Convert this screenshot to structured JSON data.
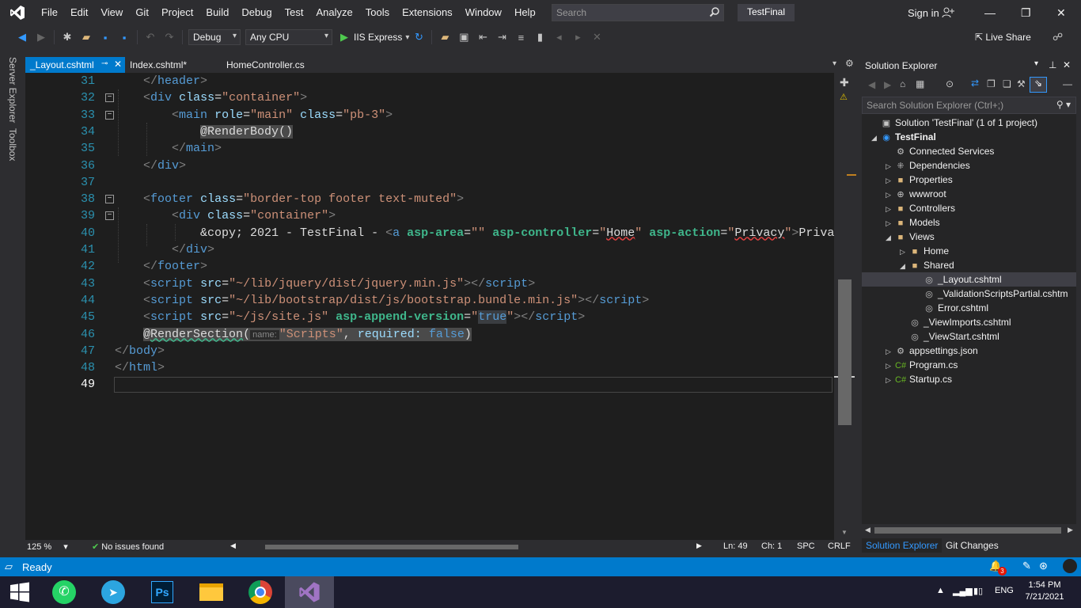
{
  "menu": {
    "items": [
      "File",
      "Edit",
      "View",
      "Git",
      "Project",
      "Build",
      "Debug",
      "Test",
      "Analyze",
      "Tools",
      "Extensions",
      "Window",
      "Help"
    ],
    "search_placeholder": "Search",
    "solution_name": "TestFinal",
    "sign_in": "Sign in"
  },
  "toolbar": {
    "config": "Debug",
    "platform": "Any CPU",
    "run_target": "IIS Express",
    "live_share": "Live Share"
  },
  "side_tabs": [
    "Server Explorer",
    "Toolbox"
  ],
  "tabs": [
    {
      "label": "_Layout.cshtml",
      "active": true
    },
    {
      "label": "Index.cshtml*",
      "active": false
    },
    {
      "label": "HomeController.cs",
      "active": false
    }
  ],
  "code_lines": [
    {
      "n": "31",
      "html": "    <span class=\"tag\">&lt;/</span><span class=\"tn\">header</span><span class=\"tag\">&gt;</span>"
    },
    {
      "n": "32",
      "html": "    <span class=\"tag\">&lt;</span><span class=\"tn\">div</span> <span class=\"at\">class</span><span class=\"txt\">=</span><span class=\"av\">\"container\"</span><span class=\"tag\">&gt;</span>"
    },
    {
      "n": "33",
      "html": "        <span class=\"tag\">&lt;</span><span class=\"tn\">main</span> <span class=\"at\">role</span><span class=\"txt\">=</span><span class=\"av\">\"main\"</span> <span class=\"at\">class</span><span class=\"txt\">=</span><span class=\"av\">\"pb-3\"</span><span class=\"tag\">&gt;</span>"
    },
    {
      "n": "34",
      "html": "            <span class=\"razor\">@RenderBody()</span>"
    },
    {
      "n": "35",
      "html": "        <span class=\"tag\">&lt;/</span><span class=\"tn\">main</span><span class=\"tag\">&gt;</span>"
    },
    {
      "n": "36",
      "html": "    <span class=\"tag\">&lt;/</span><span class=\"tn\">div</span><span class=\"tag\">&gt;</span>"
    },
    {
      "n": "37",
      "html": ""
    },
    {
      "n": "38",
      "html": "    <span class=\"tag\">&lt;</span><span class=\"tn\">footer</span> <span class=\"at\">class</span><span class=\"txt\">=</span><span class=\"av\">\"border-top footer text-muted\"</span><span class=\"tag\">&gt;</span>"
    },
    {
      "n": "39",
      "html": "        <span class=\"tag\">&lt;</span><span class=\"tn\">div</span> <span class=\"at\">class</span><span class=\"txt\">=</span><span class=\"av\">\"container\"</span><span class=\"tag\">&gt;</span>"
    },
    {
      "n": "40",
      "html": "            <span class=\"txt\">&amp;copy; 2021 - TestFinal - </span><span class=\"tag\">&lt;</span><span class=\"tn\">a</span> <span class=\"at\" style=\"color:#3fb68b;font-weight:bold\">asp-area</span><span class=\"txt\">=</span><span class=\"av\">\"\"</span> <span class=\"at\" style=\"color:#3fb68b;font-weight:bold\">asp-controller</span><span class=\"txt\">=</span><span class=\"av\">\"</span><span class=\"txt\" style=\"text-decoration:underline wavy #e04040\">Home</span><span class=\"av\">\"</span> <span class=\"at\" style=\"color:#3fb68b;font-weight:bold\">asp-action</span><span class=\"txt\">=</span><span class=\"av\">\"</span><span class=\"txt\" style=\"text-decoration:underline wavy #e04040\">Privacy</span><span class=\"av\">\"</span><span class=\"tag\">&gt;</span><span class=\"txt\">Privac</span>"
    },
    {
      "n": "41",
      "html": "        <span class=\"tag\">&lt;/</span><span class=\"tn\">div</span><span class=\"tag\">&gt;</span>"
    },
    {
      "n": "42",
      "html": "    <span class=\"tag\">&lt;/</span><span class=\"tn\">footer</span><span class=\"tag\">&gt;</span>"
    },
    {
      "n": "43",
      "html": "    <span class=\"tag\">&lt;</span><span class=\"tn\">script</span> <span class=\"at\">src</span><span class=\"txt\">=</span><span class=\"av\">\"~/lib/jquery/dist/jquery.min.js\"</span><span class=\"tag\">&gt;&lt;/</span><span class=\"tn\">script</span><span class=\"tag\">&gt;</span>"
    },
    {
      "n": "44",
      "html": "    <span class=\"tag\">&lt;</span><span class=\"tn\">script</span> <span class=\"at\">src</span><span class=\"txt\">=</span><span class=\"av\">\"~/lib/bootstrap/dist/js/bootstrap.bundle.min.js\"</span><span class=\"tag\">&gt;&lt;/</span><span class=\"tn\">script</span><span class=\"tag\">&gt;</span>"
    },
    {
      "n": "45",
      "html": "    <span class=\"tag\">&lt;</span><span class=\"tn\">script</span> <span class=\"at\">src</span><span class=\"txt\">=</span><span class=\"av\">\"~/js/site.js\"</span> <span class=\"at\" style=\"color:#3fb68b;font-weight:bold\">asp-append-version</span><span class=\"txt\">=</span><span class=\"av\">\"</span><span class=\"tn\" style=\"background:#3a3d41\">true</span><span class=\"av\">\"</span><span class=\"tag\">&gt;&lt;/</span><span class=\"tn\">script</span><span class=\"tag\">&gt;</span>"
    },
    {
      "n": "46",
      "html": "    <span class=\"razor\">@<span style=\"text-decoration:underline wavy #3fb68b\">RenderSection</span>(<span class=\"hint\"> name: </span><span class=\"av\">\"Scripts\"</span>, <span class=\"at\">required:</span> <span class=\"tn\">false</span>)</span>"
    },
    {
      "n": "47",
      "html": "<span class=\"tag\">&lt;/</span><span class=\"tn\">body</span><span class=\"tag\">&gt;</span>"
    },
    {
      "n": "48",
      "html": "<span class=\"tag\">&lt;/</span><span class=\"tn\">html</span><span class=\"tag\">&gt;</span>"
    },
    {
      "n": "49",
      "html": ""
    }
  ],
  "editor_status": {
    "zoom": "125 %",
    "issues": "No issues found",
    "ln": "Ln: 49",
    "ch": "Ch: 1",
    "spc": "SPC",
    "crlf": "CRLF"
  },
  "solution_explorer": {
    "title": "Solution Explorer",
    "search_placeholder": "Search Solution Explorer (Ctrl+;)",
    "tree": [
      {
        "label": "Solution 'TestFinal' (1 of 1 project)",
        "depth": 0,
        "arrow": "",
        "icon": "▣",
        "color": "#c5c5c5"
      },
      {
        "label": "TestFinal",
        "depth": 0,
        "arrow": "◢",
        "icon": "◉",
        "color": "#3399ff",
        "bold": true
      },
      {
        "label": "Connected Services",
        "depth": 1,
        "arrow": "",
        "icon": "⚙",
        "color": "#c5c5c5"
      },
      {
        "label": "Dependencies",
        "depth": 1,
        "arrow": "▷",
        "icon": "⁜",
        "color": "#c5c5c5"
      },
      {
        "label": "Properties",
        "depth": 1,
        "arrow": "▷",
        "icon": "■",
        "color": "#dcb67a"
      },
      {
        "label": "wwwroot",
        "depth": 1,
        "arrow": "▷",
        "icon": "⊕",
        "color": "#c5c5c5"
      },
      {
        "label": "Controllers",
        "depth": 1,
        "arrow": "▷",
        "icon": "■",
        "color": "#dcb67a"
      },
      {
        "label": "Models",
        "depth": 1,
        "arrow": "▷",
        "icon": "■",
        "color": "#dcb67a"
      },
      {
        "label": "Views",
        "depth": 1,
        "arrow": "◢",
        "icon": "■",
        "color": "#dcb67a"
      },
      {
        "label": "Home",
        "depth": 2,
        "arrow": "▷",
        "icon": "■",
        "color": "#dcb67a"
      },
      {
        "label": "Shared",
        "depth": 2,
        "arrow": "◢",
        "icon": "■",
        "color": "#dcb67a"
      },
      {
        "label": "_Layout.cshtml",
        "depth": 3,
        "arrow": "",
        "icon": "◎",
        "color": "#c5c5c5",
        "selected": true
      },
      {
        "label": "_ValidationScriptsPartial.cshtm",
        "depth": 3,
        "arrow": "",
        "icon": "◎",
        "color": "#c5c5c5"
      },
      {
        "label": "Error.cshtml",
        "depth": 3,
        "arrow": "",
        "icon": "◎",
        "color": "#c5c5c5"
      },
      {
        "label": "_ViewImports.cshtml",
        "depth": 2,
        "arrow": "",
        "icon": "◎",
        "color": "#c5c5c5"
      },
      {
        "label": "_ViewStart.cshtml",
        "depth": 2,
        "arrow": "",
        "icon": "◎",
        "color": "#c5c5c5"
      },
      {
        "label": "appsettings.json",
        "depth": 1,
        "arrow": "▷",
        "icon": "⚙",
        "color": "#c5c5c5"
      },
      {
        "label": "Program.cs",
        "depth": 1,
        "arrow": "▷",
        "icon": "C#",
        "color": "#68b723"
      },
      {
        "label": "Startup.cs",
        "depth": 1,
        "arrow": "▷",
        "icon": "C#",
        "color": "#68b723"
      }
    ],
    "tab_active": "Solution Explorer",
    "tab_other": "Git Changes"
  },
  "status": {
    "ready": "Ready",
    "notif_count": "3"
  },
  "taskbar": {
    "lang": "ENG",
    "time": "1:54 PM",
    "date": "7/21/2021"
  }
}
